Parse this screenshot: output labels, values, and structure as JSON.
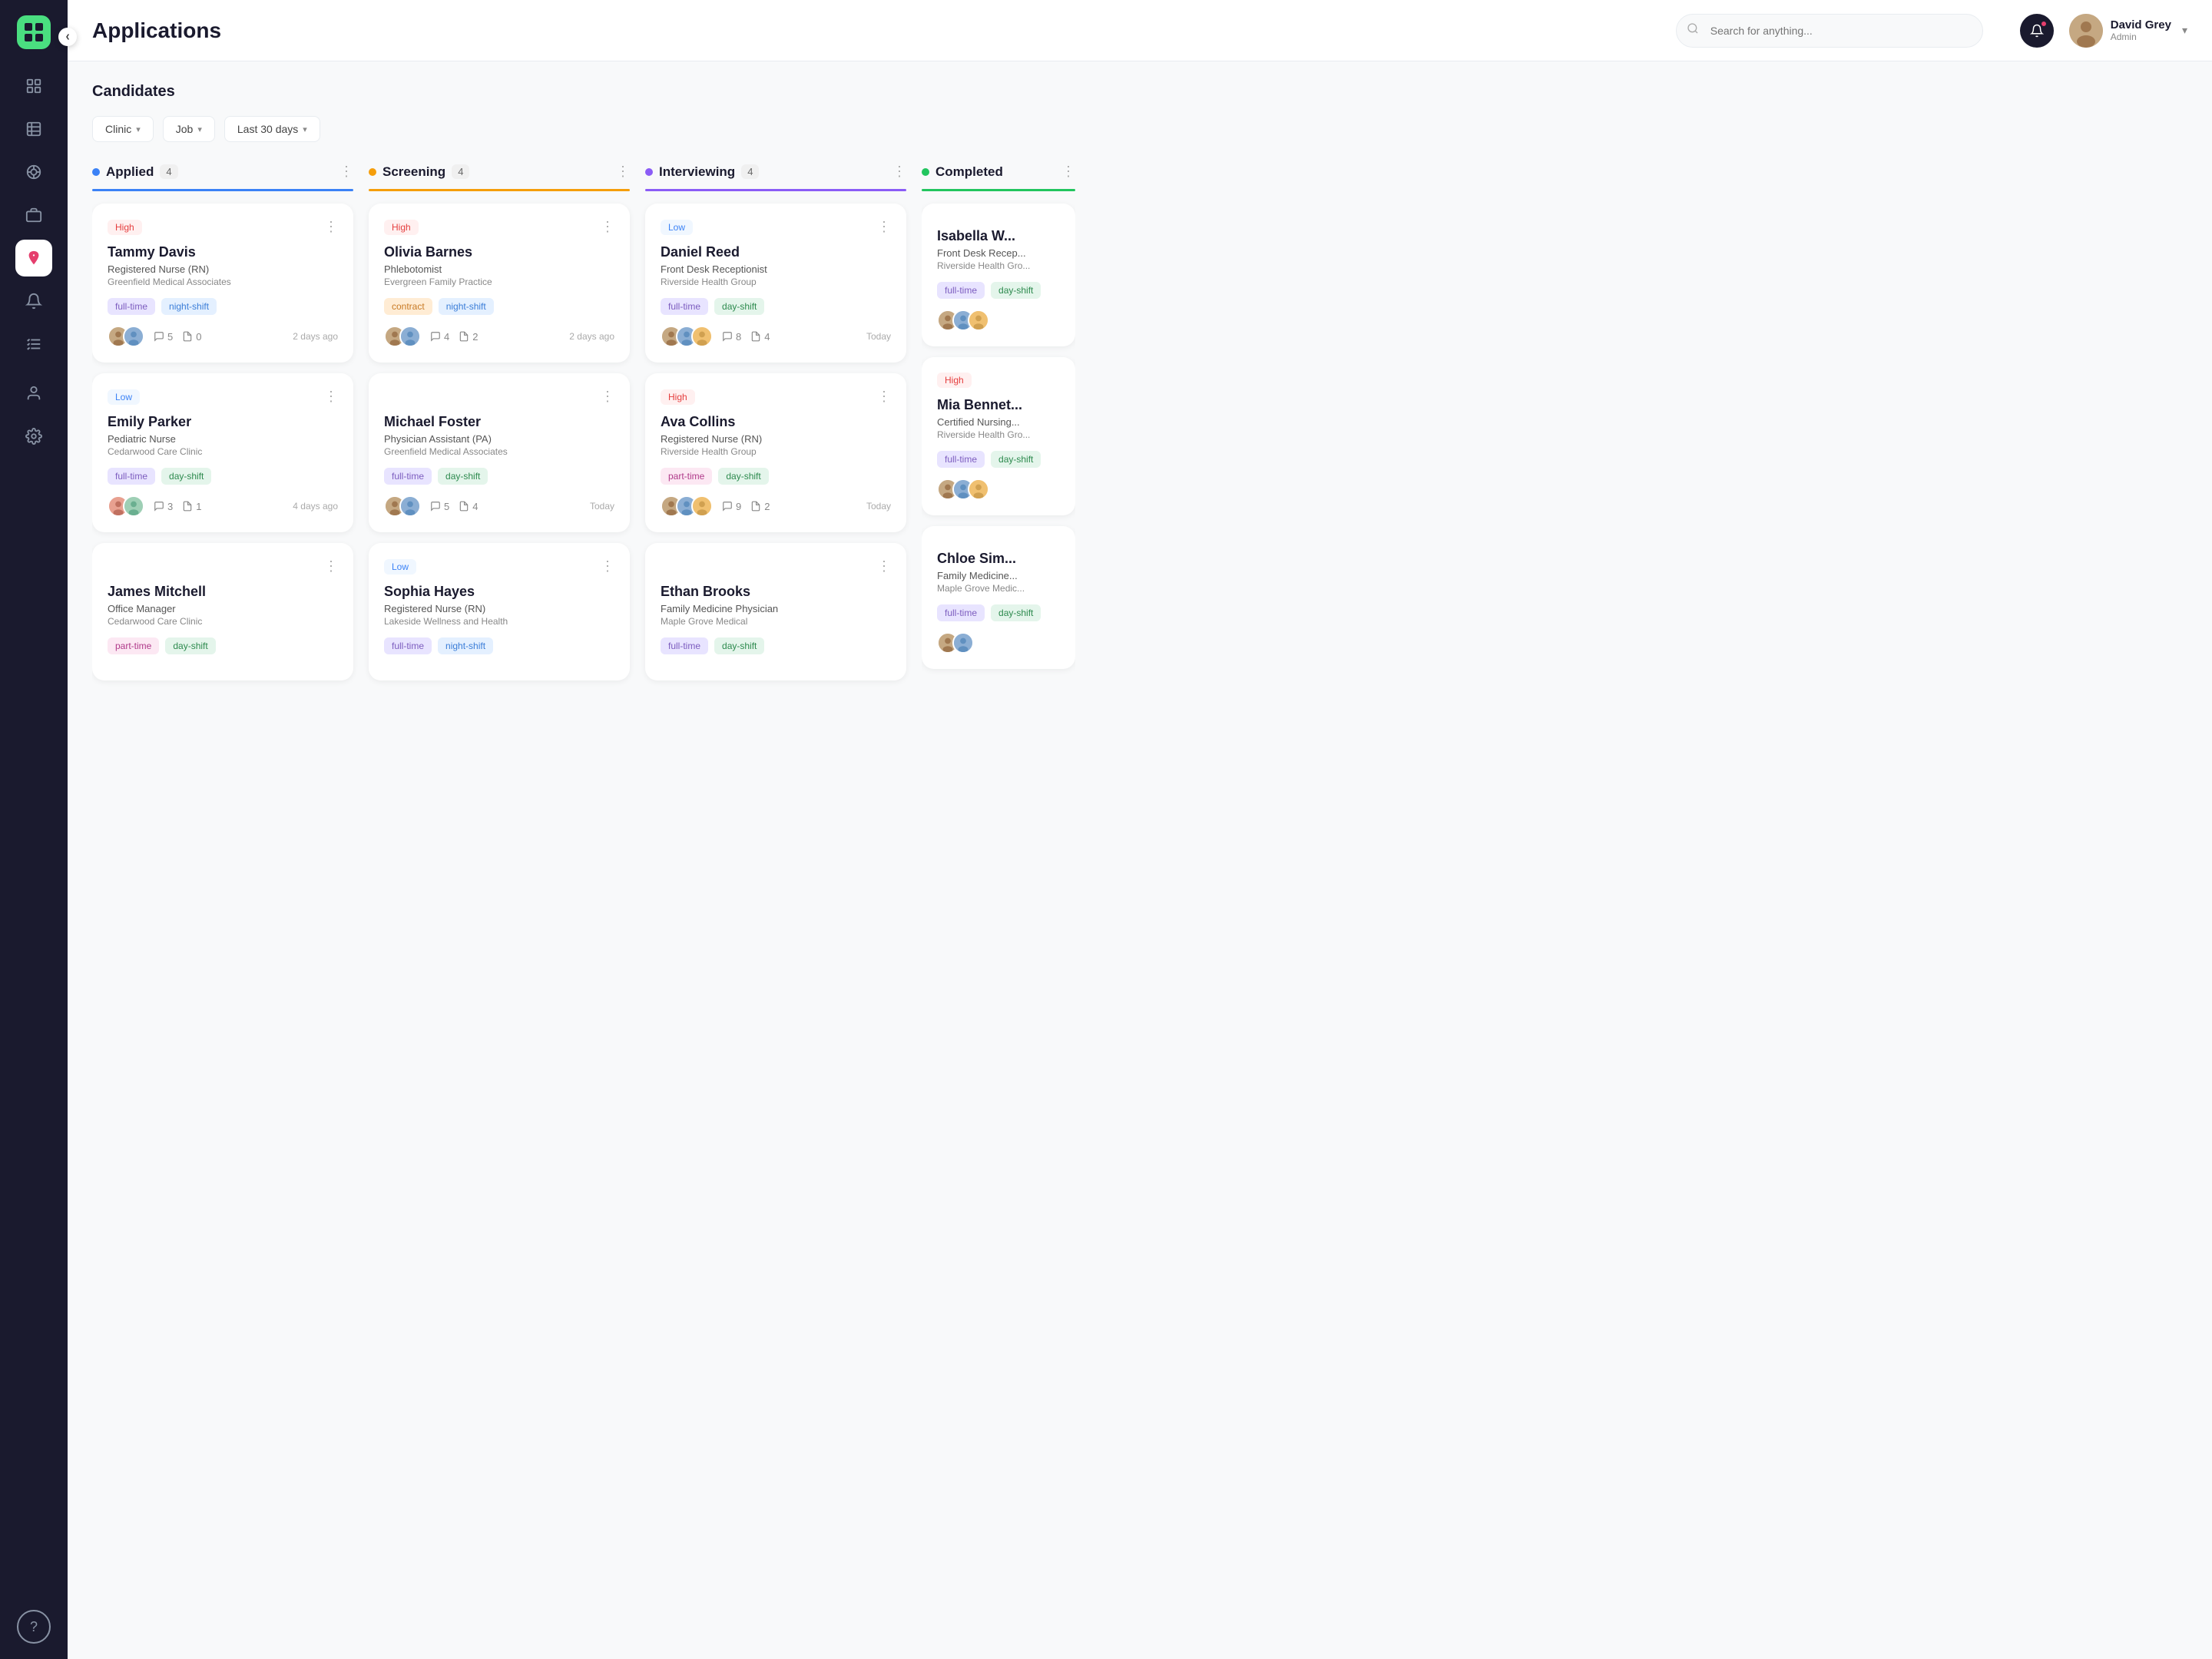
{
  "header": {
    "title": "Applications",
    "search_placeholder": "Search for anything...",
    "user": {
      "name": "David Grey",
      "role": "Admin"
    }
  },
  "page": {
    "subtitle": "Candidates"
  },
  "filters": [
    {
      "label": "Clinic"
    },
    {
      "label": "Job"
    },
    {
      "label": "Last 30 days"
    }
  ],
  "columns": [
    {
      "id": "applied",
      "title": "Applied",
      "count": "4",
      "dot_color": "#3b82f6",
      "line_color": "#3b82f6",
      "cards": [
        {
          "priority": "High",
          "priority_type": "high",
          "name": "Tammy Davis",
          "role": "Registered Nurse (RN)",
          "clinic": "Greenfield Medical Associates",
          "tags": [
            {
              "label": "full-time",
              "type": "fulltime"
            },
            {
              "label": "night-shift",
              "type": "nightshift"
            }
          ],
          "avatars": [
            "👩",
            "👨"
          ],
          "comments": "5",
          "files": "0",
          "time": "2 days ago"
        },
        {
          "priority": "Low",
          "priority_type": "low",
          "name": "Emily Parker",
          "role": "Pediatric Nurse",
          "clinic": "Cedarwood Care Clinic",
          "tags": [
            {
              "label": "full-time",
              "type": "fulltime"
            },
            {
              "label": "day-shift",
              "type": "dayshift"
            }
          ],
          "avatars": [
            "👩",
            "👨"
          ],
          "comments": "3",
          "files": "1",
          "time": "4 days ago"
        },
        {
          "priority": "",
          "priority_type": "",
          "name": "James Mitchell",
          "role": "Office Manager",
          "clinic": "Cedarwood Care Clinic",
          "tags": [
            {
              "label": "part-time",
              "type": "parttime"
            },
            {
              "label": "day-shift",
              "type": "dayshift"
            }
          ],
          "avatars": [],
          "comments": "",
          "files": "",
          "time": ""
        }
      ]
    },
    {
      "id": "screening",
      "title": "Screening",
      "count": "4",
      "dot_color": "#f59e0b",
      "line_color": "#f59e0b",
      "cards": [
        {
          "priority": "High",
          "priority_type": "high",
          "name": "Olivia Barnes",
          "role": "Phlebotomist",
          "clinic": "Evergreen Family Practice",
          "tags": [
            {
              "label": "contract",
              "type": "contract"
            },
            {
              "label": "night-shift",
              "type": "nightshift"
            }
          ],
          "avatars": [
            "👩",
            "👨"
          ],
          "comments": "4",
          "files": "2",
          "time": "2 days ago"
        },
        {
          "priority": "",
          "priority_type": "",
          "name": "Michael Foster",
          "role": "Physician Assistant (PA)",
          "clinic": "Greenfield Medical Associates",
          "tags": [
            {
              "label": "full-time",
              "type": "fulltime"
            },
            {
              "label": "day-shift",
              "type": "dayshift"
            }
          ],
          "avatars": [
            "👩",
            "👨"
          ],
          "comments": "5",
          "files": "4",
          "time": "Today"
        },
        {
          "priority": "Low",
          "priority_type": "low",
          "name": "Sophia Hayes",
          "role": "Registered Nurse (RN)",
          "clinic": "Lakeside Wellness and Health",
          "tags": [
            {
              "label": "full-time",
              "type": "fulltime"
            },
            {
              "label": "night-shift",
              "type": "nightshift"
            }
          ],
          "avatars": [],
          "comments": "",
          "files": "",
          "time": ""
        }
      ]
    },
    {
      "id": "interviewing",
      "title": "Interviewing",
      "count": "4",
      "dot_color": "#8b5cf6",
      "line_color": "#8b5cf6",
      "cards": [
        {
          "priority": "Low",
          "priority_type": "low",
          "name": "Daniel Reed",
          "role": "Front Desk Receptionist",
          "clinic": "Riverside Health Group",
          "tags": [
            {
              "label": "full-time",
              "type": "fulltime"
            },
            {
              "label": "day-shift",
              "type": "dayshift"
            }
          ],
          "avatars": [
            "👩",
            "👨",
            "👱"
          ],
          "comments": "8",
          "files": "4",
          "time": "Today"
        },
        {
          "priority": "High",
          "priority_type": "high",
          "name": "Ava Collins",
          "role": "Registered Nurse (RN)",
          "clinic": "Riverside Health Group",
          "tags": [
            {
              "label": "part-time",
              "type": "parttime"
            },
            {
              "label": "day-shift",
              "type": "dayshift"
            }
          ],
          "avatars": [
            "👩",
            "👨",
            "👱"
          ],
          "comments": "9",
          "files": "2",
          "time": "Today"
        },
        {
          "priority": "",
          "priority_type": "",
          "name": "Ethan Brooks",
          "role": "Family Medicine Physician",
          "clinic": "Maple Grove Medical",
          "tags": [
            {
              "label": "full-time",
              "type": "fulltime"
            },
            {
              "label": "day-shift",
              "type": "dayshift"
            }
          ],
          "avatars": [],
          "comments": "",
          "files": "",
          "time": ""
        }
      ]
    },
    {
      "id": "completed",
      "title": "Completed",
      "count": "",
      "dot_color": "#22c55e",
      "line_color": "#22c55e",
      "partial": true,
      "cards": [
        {
          "priority": "",
          "priority_type": "",
          "name": "Isabella W...",
          "role": "Front Desk Recep...",
          "clinic": "Riverside Health Gro...",
          "tags": [
            {
              "label": "full-time",
              "type": "fulltime"
            },
            {
              "label": "day-shift",
              "type": "dayshift"
            }
          ],
          "avatars": [
            "👩",
            "👨",
            "👱"
          ],
          "comments": "",
          "files": "",
          "time": ""
        },
        {
          "priority": "High",
          "priority_type": "high",
          "name": "Mia Bennet...",
          "role": "Certified Nursing...",
          "clinic": "Riverside Health Gro...",
          "tags": [
            {
              "label": "full-time",
              "type": "fulltime"
            },
            {
              "label": "day-shift",
              "type": "dayshift"
            }
          ],
          "avatars": [
            "👩",
            "👨",
            "👱"
          ],
          "comments": "",
          "files": "",
          "time": ""
        },
        {
          "priority": "",
          "priority_type": "",
          "name": "Chloe Sim...",
          "role": "Family Medicine...",
          "clinic": "Maple Grove Medic...",
          "tags": [
            {
              "label": "full-time",
              "type": "fulltime"
            },
            {
              "label": "day-shift",
              "type": "dayshift"
            }
          ],
          "avatars": [
            "👩",
            "👨"
          ],
          "comments": "",
          "files": "",
          "time": ""
        }
      ]
    }
  ],
  "sidebar": {
    "items": [
      {
        "icon": "⊞",
        "name": "dashboard"
      },
      {
        "icon": "▤",
        "name": "reports"
      },
      {
        "icon": "⚇",
        "name": "network"
      },
      {
        "icon": "💼",
        "name": "jobs"
      },
      {
        "icon": "◉",
        "name": "applications",
        "active": true
      },
      {
        "icon": "🔔",
        "name": "notifications"
      },
      {
        "icon": "≡",
        "name": "tasks"
      },
      {
        "icon": "👤",
        "name": "profile"
      },
      {
        "icon": "⚙",
        "name": "settings"
      }
    ],
    "help": "?"
  }
}
